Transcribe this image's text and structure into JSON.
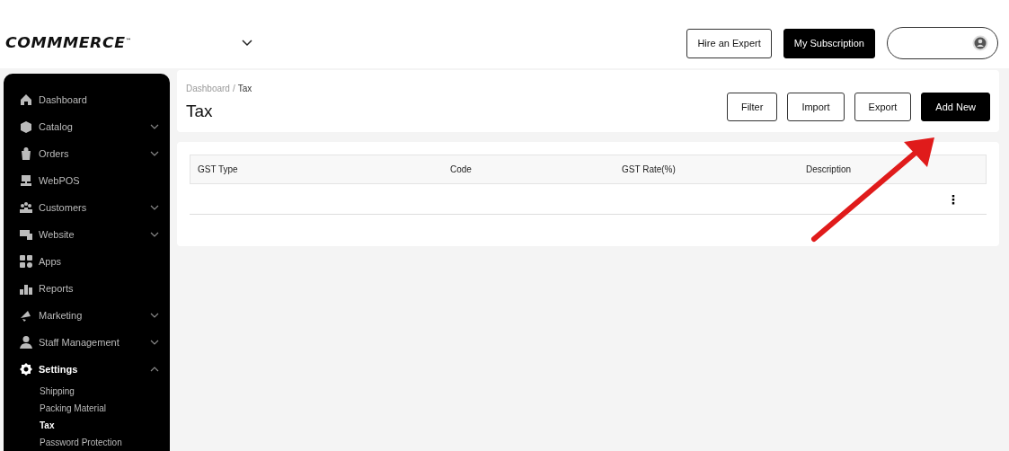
{
  "header": {
    "logo": "COMMMERCE",
    "logo_mark": "™",
    "buttons": [
      {
        "label": "Hire an Expert",
        "kind": "outline"
      },
      {
        "label": "My Subscription",
        "kind": "solid"
      }
    ]
  },
  "sidebar": {
    "items": [
      {
        "label": "Dashboard",
        "kind": "link",
        "selected": false
      },
      {
        "label": "Catalog",
        "kind": "group",
        "selected": false,
        "expanded": false
      },
      {
        "label": "Orders",
        "kind": "group",
        "selected": false,
        "expanded": false
      },
      {
        "label": "WebPOS",
        "kind": "link",
        "selected": false
      },
      {
        "label": "Customers",
        "kind": "group",
        "selected": false,
        "expanded": false
      },
      {
        "label": "Website",
        "kind": "group",
        "selected": false,
        "expanded": false
      },
      {
        "label": "Apps",
        "kind": "link",
        "selected": false
      },
      {
        "label": "Reports",
        "kind": "link",
        "selected": false
      },
      {
        "label": "Marketing",
        "kind": "group",
        "selected": false,
        "expanded": false
      },
      {
        "label": "Staff Management",
        "kind": "group",
        "selected": false,
        "expanded": false
      },
      {
        "label": "Settings",
        "kind": "group",
        "selected": true,
        "expanded": true,
        "children": [
          {
            "label": "Shipping",
            "selected": false
          },
          {
            "label": "Packing Material",
            "selected": false
          },
          {
            "label": "Tax",
            "selected": true
          },
          {
            "label": "Password Protection",
            "selected": false
          }
        ]
      }
    ]
  },
  "page": {
    "breadcrumb": [
      {
        "label": "Dashboard",
        "current": false
      },
      {
        "label": "Tax",
        "current": true
      }
    ],
    "breadcrumb_separator": "/",
    "title": "Tax",
    "actions": [
      {
        "label": "Filter",
        "kind": "outline"
      },
      {
        "label": "Import",
        "kind": "outline"
      },
      {
        "label": "Export",
        "kind": "outline"
      },
      {
        "label": "Add New",
        "kind": "solid"
      }
    ]
  },
  "table": {
    "columns": [
      "GST Type",
      "Code",
      "GST Rate(%)",
      "Description"
    ],
    "row_menu": "⋮"
  }
}
